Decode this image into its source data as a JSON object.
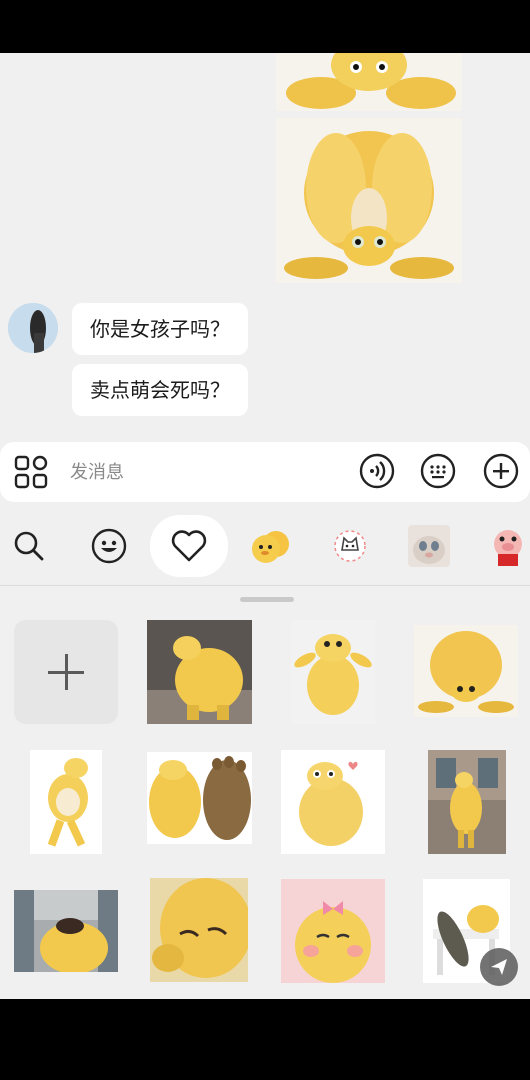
{
  "chat": {
    "messages": [
      {
        "text": "你是女孩子吗？"
      },
      {
        "text": "卖点萌会死吗？"
      }
    ]
  },
  "input": {
    "placeholder": "发消息"
  },
  "icons": {
    "apps": "apps-grid-icon",
    "voice": "voice-icon",
    "keyboard": "keyboard-icon",
    "plus": "plus-circle-icon",
    "search": "search-icon",
    "emoji": "emoji-smile-icon",
    "favorites": "heart-icon"
  },
  "colors": {
    "background": "#f0f0f0",
    "bubble": "#ffffff",
    "sticker_yellow": "#f2c94c"
  }
}
